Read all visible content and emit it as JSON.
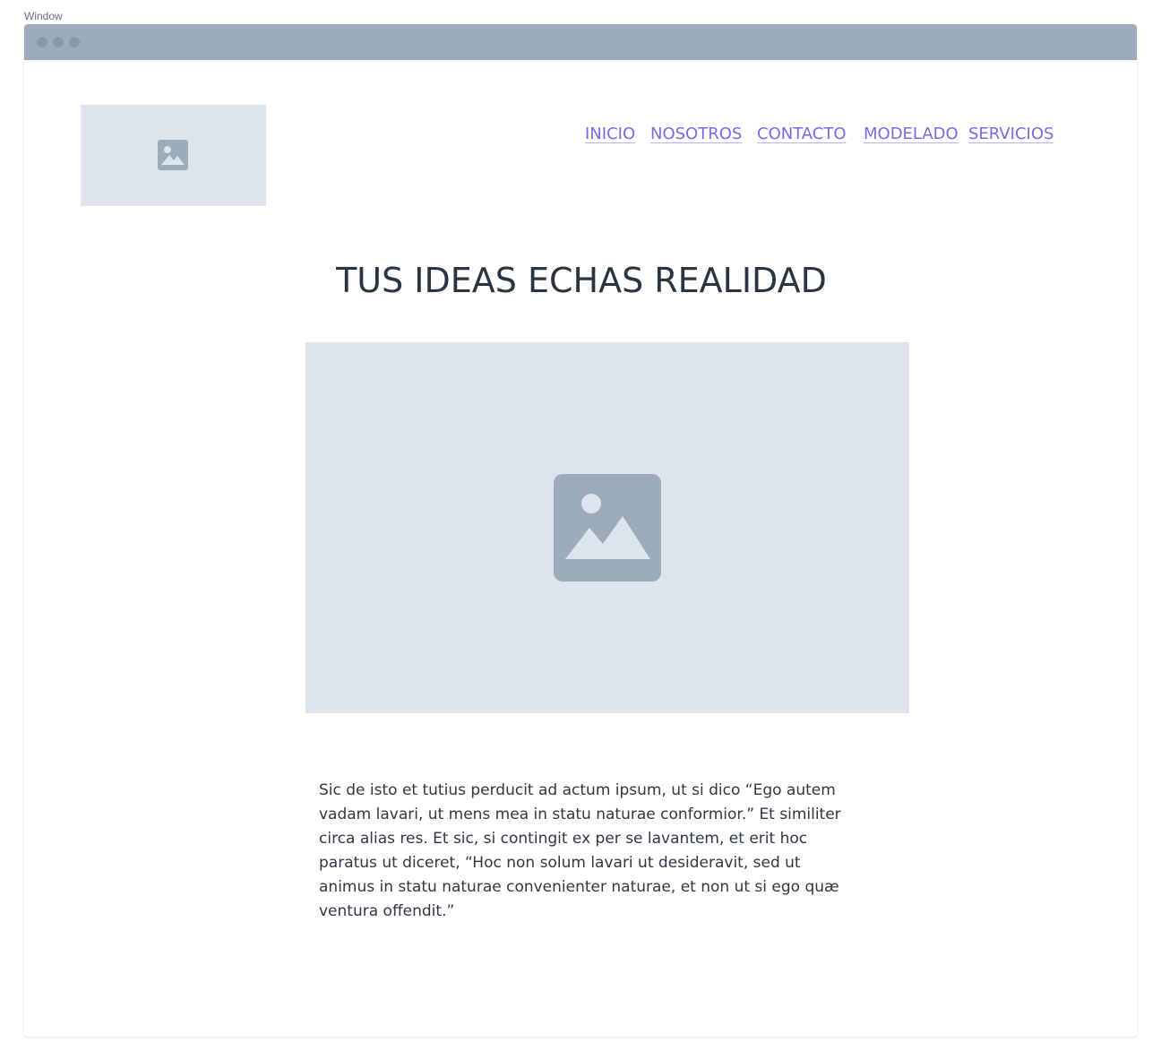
{
  "window": {
    "label": "Window"
  },
  "header": {
    "logo_icon": "image-placeholder-icon",
    "nav": [
      {
        "label": "INICIO"
      },
      {
        "label": "NOSOTROS"
      },
      {
        "label": "CONTACTO"
      },
      {
        "label": "MODELADO"
      },
      {
        "label": "SERVICIOS"
      }
    ]
  },
  "hero": {
    "title": "TUS IDEAS ECHAS REALIDAD",
    "image_icon": "image-placeholder-icon"
  },
  "content": {
    "paragraph": "Sic de isto et tutius perducit ad actum ipsum, ut si dico “Ego autem vadam lavari, ut mens mea in statu naturae conformior.” Et similiter circa alias res. Et sic, si contingit ex per se lavantem, et erit hoc paratus ut diceret, “Hoc non solum lavari ut desideravit, sed ut animus in statu naturae convenienter naturae, et non ut si ego quæ ventura offendit.”"
  },
  "colors": {
    "accent": "#7b68e8",
    "titlebar": "#9dacba",
    "placeholder": "#dee4ed",
    "placeholder_icon": "#9dacba",
    "text": "#2b3440"
  }
}
